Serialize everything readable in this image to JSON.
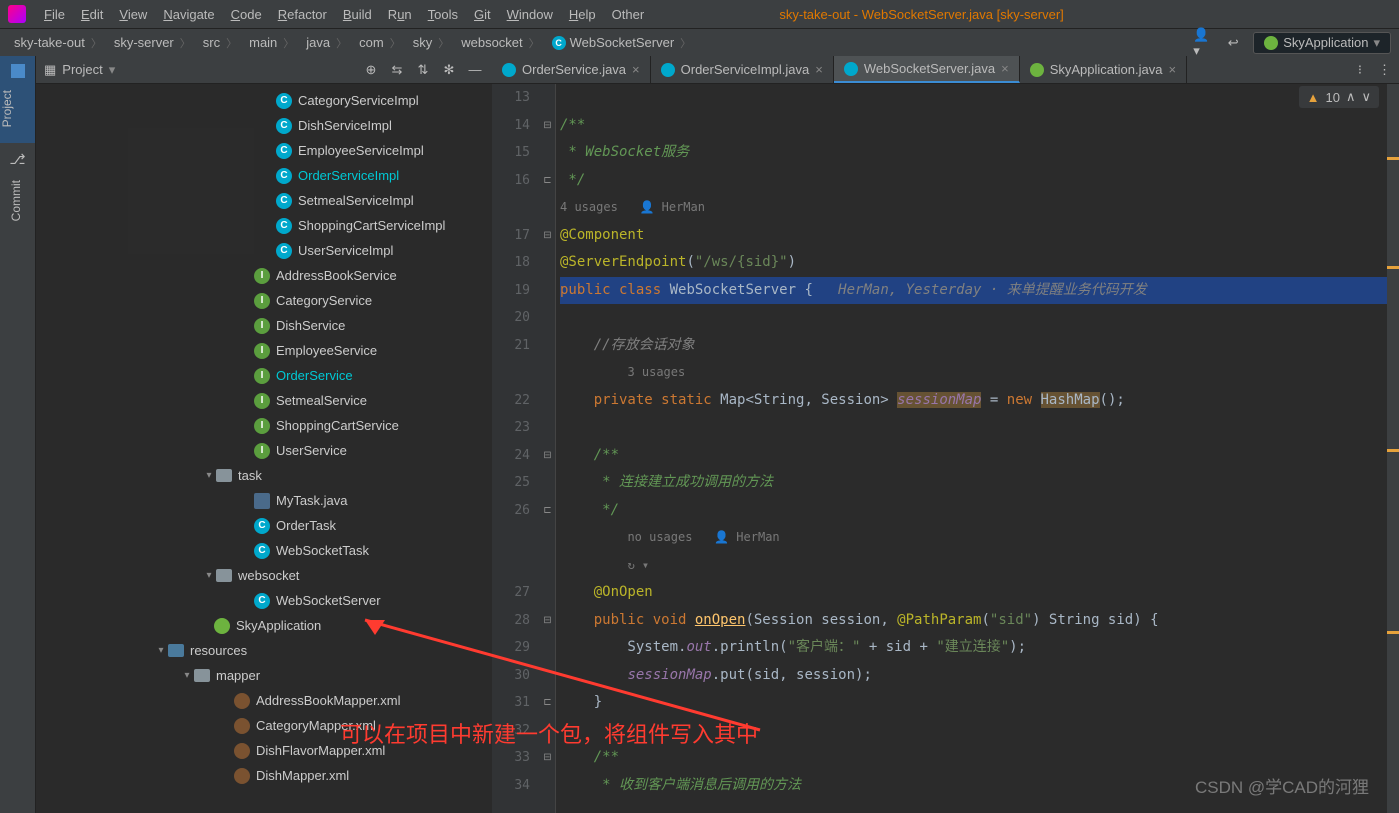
{
  "window": {
    "title": "sky-take-out - WebSocketServer.java [sky-server]"
  },
  "menu": [
    "File",
    "Edit",
    "View",
    "Navigate",
    "Code",
    "Refactor",
    "Build",
    "Run",
    "Tools",
    "Git",
    "Window",
    "Help",
    "Other"
  ],
  "breadcrumbs": [
    "sky-take-out",
    "sky-server",
    "src",
    "main",
    "java",
    "com",
    "sky",
    "websocket",
    "WebSocketServer"
  ],
  "runConfig": "SkyApplication",
  "sidebar": {
    "title": "Project",
    "gutter": {
      "project": "Project",
      "commit": "Commit"
    }
  },
  "tree": [
    {
      "pad": 240,
      "icon": "c",
      "label": "CategoryServiceImpl"
    },
    {
      "pad": 240,
      "icon": "c",
      "label": "DishServiceImpl"
    },
    {
      "pad": 240,
      "icon": "c",
      "label": "EmployeeServiceImpl"
    },
    {
      "pad": 240,
      "icon": "c",
      "label": "OrderServiceImpl",
      "hl": true
    },
    {
      "pad": 240,
      "icon": "c",
      "label": "SetmealServiceImpl"
    },
    {
      "pad": 240,
      "icon": "c",
      "label": "ShoppingCartServiceImpl"
    },
    {
      "pad": 240,
      "icon": "c",
      "label": "UserServiceImpl"
    },
    {
      "pad": 218,
      "icon": "i",
      "label": "AddressBookService"
    },
    {
      "pad": 218,
      "icon": "i",
      "label": "CategoryService"
    },
    {
      "pad": 218,
      "icon": "i",
      "label": "DishService"
    },
    {
      "pad": 218,
      "icon": "i",
      "label": "EmployeeService"
    },
    {
      "pad": 218,
      "icon": "i",
      "label": "OrderService",
      "hl": true
    },
    {
      "pad": 218,
      "icon": "i",
      "label": "SetmealService"
    },
    {
      "pad": 218,
      "icon": "i",
      "label": "ShoppingCartService"
    },
    {
      "pad": 218,
      "icon": "i",
      "label": "UserService"
    },
    {
      "pad": 180,
      "arrow": "v",
      "icon": "folder",
      "label": "task"
    },
    {
      "pad": 218,
      "icon": "java",
      "label": "MyTask.java"
    },
    {
      "pad": 218,
      "icon": "c",
      "label": "OrderTask"
    },
    {
      "pad": 218,
      "icon": "c",
      "label": "WebSocketTask"
    },
    {
      "pad": 180,
      "arrow": "v",
      "icon": "folder",
      "label": "websocket"
    },
    {
      "pad": 218,
      "icon": "c",
      "label": "WebSocketServer"
    },
    {
      "pad": 178,
      "icon": "spring",
      "label": "SkyApplication"
    },
    {
      "pad": 132,
      "arrow": "v",
      "icon": "folder-res",
      "label": "resources"
    },
    {
      "pad": 158,
      "arrow": "v",
      "icon": "folder",
      "label": "mapper"
    },
    {
      "pad": 198,
      "icon": "xml",
      "label": "AddressBookMapper.xml"
    },
    {
      "pad": 198,
      "icon": "xml",
      "label": "CategoryMapper.xml"
    },
    {
      "pad": 198,
      "icon": "xml",
      "label": "DishFlavorMapper.xml"
    },
    {
      "pad": 198,
      "icon": "xml",
      "label": "DishMapper.xml"
    }
  ],
  "tabs": [
    {
      "icon": "blue",
      "label": "OrderService.java"
    },
    {
      "icon": "blue",
      "label": "OrderServiceImpl.java"
    },
    {
      "icon": "blue",
      "label": "WebSocketServer.java",
      "active": true
    },
    {
      "icon": "green",
      "label": "SkyApplication.java"
    }
  ],
  "warnings": "10",
  "code": {
    "usages_top": "4 usages",
    "author": "HerMan",
    "usages_mid": "3 usages",
    "usages_none": "no usages",
    "vcs_hint": "HerMan, Yesterday · 来单提醒业务代码开发",
    "lines": {
      "13": "",
      "14": "/**",
      "15": " * WebSocket服务",
      "16": " */",
      "17": "@Component",
      "18": "@ServerEndpoint(\"/ws/{sid}\")",
      "19_a": "public class",
      "19_b": "WebSocketServer",
      "19_c": "{",
      "20": "",
      "21": "    //存放会话对象",
      "22_a": "    private static",
      "22_b": "Map<String, Session>",
      "22_c": "sessionMap",
      "22_d": "= new",
      "22_e": "HashMap",
      "22_f": "();",
      "23": "",
      "24": "    /**",
      "25": "     * 连接建立成功调用的方法",
      "26": "     */",
      "27": "    @OnOpen",
      "28_a": "    public void",
      "28_b": "onOpen",
      "28_c": "(Session session,",
      "28_d": "@PathParam",
      "28_e": "(\"sid\")",
      "28_f": "String sid) {",
      "29_a": "        System.",
      "29_b": "out",
      "29_c": ".println(",
      "29_d": "\"客户端：\"",
      "29_e": " + sid + ",
      "29_f": "\"建立连接\"",
      "29_g": ");",
      "30_a": "        ",
      "30_b": "sessionMap",
      "30_c": ".put(sid, session);",
      "31": "    }",
      "32": "",
      "33": "    /**",
      "34": "     * 收到客户端消息后调用的方法"
    }
  },
  "overlay": {
    "text": "可以在项目中新建一个包，将组件写入其中"
  },
  "watermark": "CSDN @学CAD的河狸"
}
